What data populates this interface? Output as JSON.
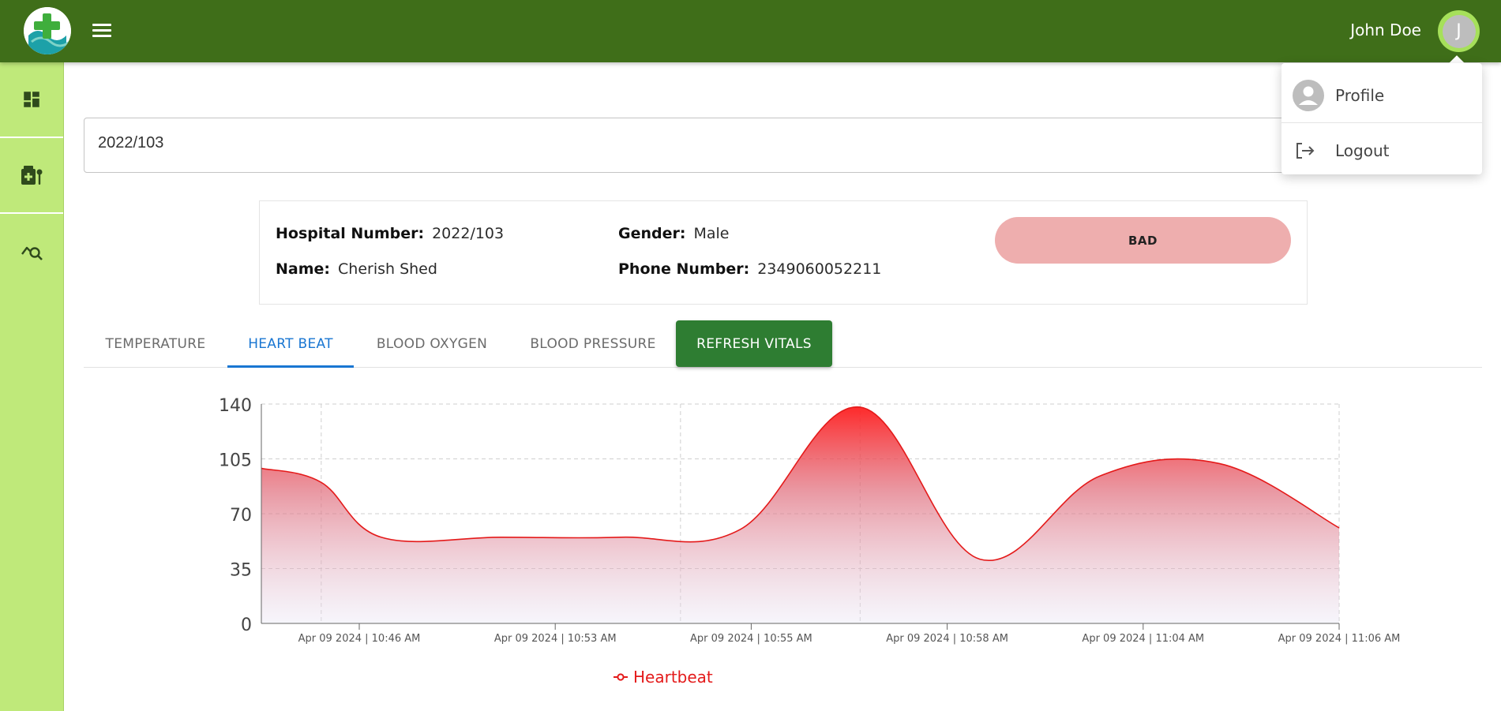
{
  "header": {
    "user_name": "John Doe",
    "avatar_initial": "J"
  },
  "user_menu": {
    "items": [
      {
        "label": "Profile",
        "icon": "person-icon"
      },
      {
        "label": "Logout",
        "icon": "logout-icon"
      }
    ]
  },
  "sidebar": {
    "items": [
      {
        "icon": "dashboard-icon"
      },
      {
        "icon": "medical-services-icon"
      },
      {
        "icon": "query-stats-icon"
      }
    ]
  },
  "search": {
    "value": "2022/103"
  },
  "patient": {
    "hospital_number_label": "Hospital Number:",
    "hospital_number": "2022/103",
    "name_label": "Name:",
    "name": "Cherish Shed",
    "gender_label": "Gender:",
    "gender": "Male",
    "phone_label": "Phone Number:",
    "phone": "2349060052211",
    "status": "BAD"
  },
  "tabs": {
    "items": [
      "TEMPERATURE",
      "HEART BEAT",
      "BLOOD OXYGEN",
      "BLOOD PRESSURE"
    ],
    "active_index": 1,
    "refresh_label": "REFRESH VITALS"
  },
  "colors": {
    "topbar": "#3f6e19",
    "sidebar": "#bfe97a",
    "accent": "#1976d2",
    "refresh": "#2e7d32",
    "status_bad": "#eeaeae",
    "series": "#e41a1a"
  },
  "chart_data": {
    "type": "area",
    "x": [
      "Apr 09 2024 | 10:46 AM",
      "Apr 09 2024 | 10:53 AM",
      "Apr 09 2024 | 10:55 AM",
      "Apr 09 2024 | 10:58 AM",
      "Apr 09 2024 | 11:04 AM",
      "Apr 09 2024 | 11:06 AM"
    ],
    "y_ticks": [
      0,
      35,
      70,
      105,
      140
    ],
    "ylim": [
      0,
      140
    ],
    "grid": true,
    "series": [
      {
        "name": "Heartbeat",
        "points": [
          {
            "x": 0.0,
            "y": 99
          },
          {
            "x": 0.5,
            "y": 90
          },
          {
            "x": 1.0,
            "y": 55
          },
          {
            "x": 2.0,
            "y": 55
          },
          {
            "x": 3.0,
            "y": 55
          },
          {
            "x": 4.0,
            "y": 60
          },
          {
            "x": 5.0,
            "y": 138
          },
          {
            "x": 6.0,
            "y": 41
          },
          {
            "x": 7.0,
            "y": 94
          },
          {
            "x": 8.0,
            "y": 102
          },
          {
            "x": 9.0,
            "y": 61
          }
        ]
      }
    ],
    "legend_position": "bottom"
  }
}
